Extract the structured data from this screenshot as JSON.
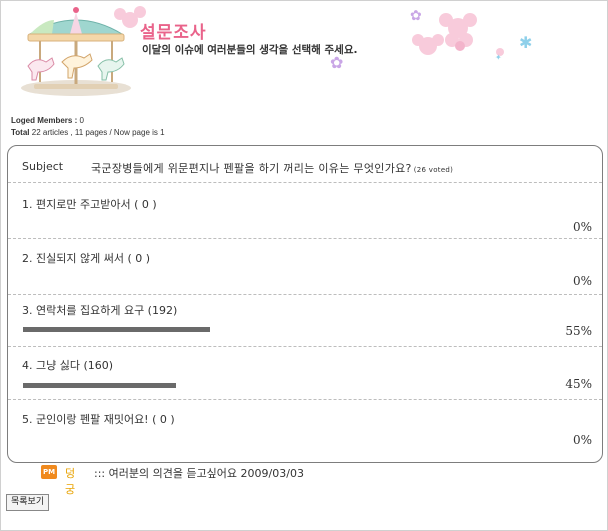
{
  "banner": {
    "title": "설문조사",
    "subtitle": "이달의 이슈에 여러분들의 생각을 선택해 주세요."
  },
  "stats": {
    "loged_label": "Loged Members :",
    "loged_value": "0",
    "total_label": "Total",
    "articles": "22 articles ,",
    "pages": "11 pages / Now page is",
    "now_page": "1"
  },
  "poll": {
    "subject_label": "Subject",
    "subject": "국군장병들에게 위문편지나 펜팔을 하기 꺼리는 이유는 무엇인가요?",
    "voted": "(26 voted)",
    "options": [
      {
        "label": "1. 편지로만 주고받아서 ( 0 )",
        "pct_text": "0%",
        "percent": 0
      },
      {
        "label": "2. 진실되지 않게 써서 ( 0 )",
        "pct_text": "0%",
        "percent": 0
      },
      {
        "label": "3. 연락처를 집요하게 요구 (192)",
        "pct_text": "55%",
        "percent": 55
      },
      {
        "label": "4. 그냥 싫다 (160)",
        "pct_text": "45%",
        "percent": 45
      },
      {
        "label": "5. 군인이랑 펜팔 재밋어요! ( 0 )",
        "pct_text": "0%",
        "percent": 0
      }
    ]
  },
  "comment": {
    "icon": "PM",
    "author": "덩궁",
    "text": "::: 여러분의 의견을 듣고싶어요 2009/03/03"
  },
  "list_button": "목록보기",
  "colors": {
    "accent": "#e9638a",
    "bar": "#6a6a6a",
    "author": "#e8a200"
  }
}
